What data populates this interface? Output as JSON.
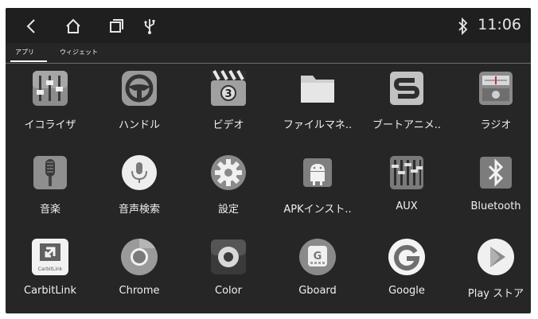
{
  "status_bar": {
    "time": "11:06",
    "icons": [
      "back-icon",
      "home-icon",
      "recent-apps-icon",
      "usb-icon",
      "bluetooth-status-icon"
    ]
  },
  "tabs": [
    {
      "label": "アプリ",
      "selected": true
    },
    {
      "label": "ウィジェット",
      "selected": false
    }
  ],
  "apps": [
    {
      "label": "イコライザ",
      "icon": "equalizer-icon"
    },
    {
      "label": "ハンドル",
      "icon": "steering-wheel-icon"
    },
    {
      "label": "ビデオ",
      "icon": "video-clapper-icon"
    },
    {
      "label": "ファイルマネ..",
      "icon": "folder-icon"
    },
    {
      "label": "ブートアニメ..",
      "icon": "boot-animation-icon"
    },
    {
      "label": "ラジオ",
      "icon": "radio-icon"
    },
    {
      "label": "音楽",
      "icon": "microphone-icon"
    },
    {
      "label": "音声検索",
      "icon": "voice-search-icon"
    },
    {
      "label": "設定",
      "icon": "settings-gear-icon"
    },
    {
      "label": "APKインスト..",
      "icon": "android-installer-icon"
    },
    {
      "label": "AUX",
      "icon": "aux-mixer-icon"
    },
    {
      "label": "Bluetooth",
      "icon": "bluetooth-icon"
    },
    {
      "label": "CarbitLink",
      "icon": "carbitlink-icon"
    },
    {
      "label": "Chrome",
      "icon": "chrome-icon"
    },
    {
      "label": "Color",
      "icon": "color-icon"
    },
    {
      "label": "Gboard",
      "icon": "gboard-icon"
    },
    {
      "label": "Google",
      "icon": "google-icon"
    },
    {
      "label": "Play ストア",
      "icon": "play-store-icon"
    }
  ],
  "icon_badge_text": {
    "video": "3",
    "carbitlink": "CarbitLink",
    "gboard": "G"
  },
  "colors": {
    "background": "#262626",
    "status_bar": "#1f1f1f",
    "text": "#f0f0f0"
  }
}
